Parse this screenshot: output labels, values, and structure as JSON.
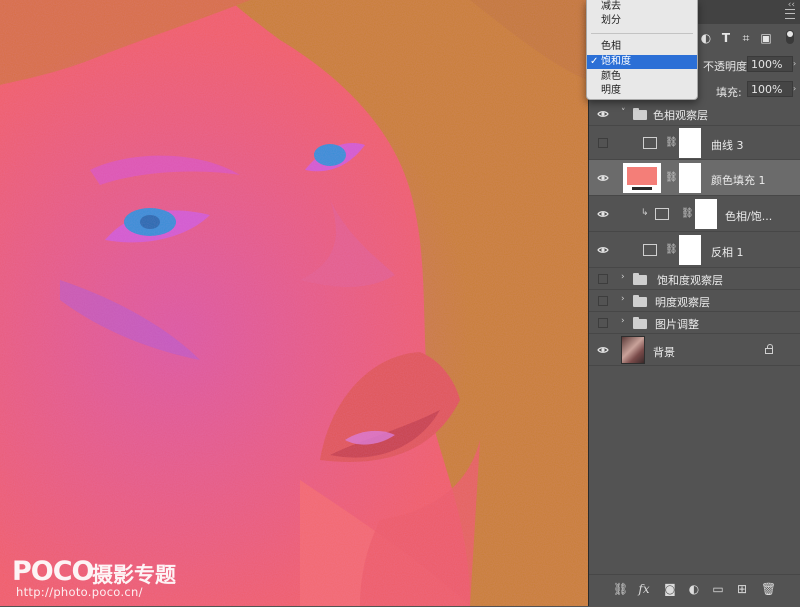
{
  "canvas": {
    "colors": {
      "base": "#f0606a",
      "hair": "#c98038",
      "magenta": "#cc55cc",
      "iris": "#3a8fd6",
      "lips": "#e0585a"
    },
    "watermark": {
      "logo": "POCO",
      "tagline": "摄影专题",
      "url": "http://photo.poco.cn/"
    }
  },
  "blend_menu": {
    "items": [
      {
        "label": "减去",
        "selected": false
      },
      {
        "label": "划分",
        "selected": false
      },
      {
        "label": "色相",
        "selected": false
      },
      {
        "label": "饱和度",
        "selected": true
      },
      {
        "label": "颜色",
        "selected": false
      },
      {
        "label": "明度",
        "selected": false
      }
    ],
    "check_mark": "✓"
  },
  "panel": {
    "opacity_label": "不透明度:",
    "opacity_value": "100%",
    "fill_label": "填充:",
    "fill_value": "100%",
    "filter_icons": [
      "adjustment-filter-icon",
      "type-filter-icon",
      "shape-filter-icon",
      "smart-object-filter-icon"
    ],
    "type_icon_glyph": "T"
  },
  "layers": [
    {
      "name": "色相观察层",
      "kind": "group",
      "visible": true,
      "expanded": true
    },
    {
      "name": "曲线 3",
      "kind": "curves",
      "visible": false
    },
    {
      "name": "颜色填充 1",
      "kind": "color-fill",
      "visible": true,
      "selected": true,
      "swatch": "#f47e78"
    },
    {
      "name": "色相/饱...",
      "kind": "hue-saturation",
      "visible": true,
      "clipped": true
    },
    {
      "name": "反相 1",
      "kind": "invert",
      "visible": true
    },
    {
      "name": "饱和度观察层",
      "kind": "group",
      "visible": false
    },
    {
      "name": "明度观察层",
      "kind": "group",
      "visible": false
    },
    {
      "name": "图片调整",
      "kind": "group",
      "visible": false
    },
    {
      "name": "背景",
      "kind": "background",
      "visible": true,
      "locked": true
    }
  ],
  "bottom_bar": {
    "fx_label": "fx",
    "icons": [
      "link-layers-icon",
      "fx-icon",
      "add-mask-icon",
      "new-adjustment-icon",
      "new-group-icon",
      "new-layer-icon",
      "trash-icon"
    ]
  }
}
